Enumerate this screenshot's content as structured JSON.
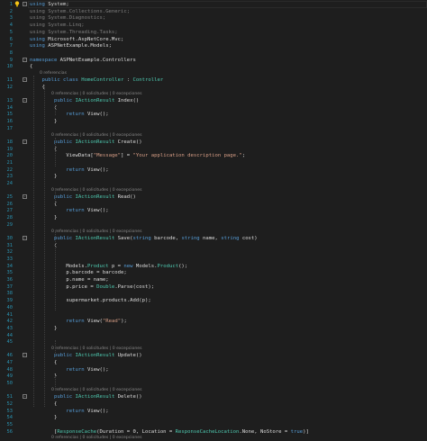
{
  "editor": {
    "codelens": {
      "0refs": "0 referencias",
      "full": "0 referencias | 0 solicitudes | 0 excepciones"
    },
    "lines": [
      {
        "n": "1",
        "fold": "-",
        "segs": [
          [
            "kw",
            "using"
          ],
          [
            "pl",
            " System;"
          ]
        ]
      },
      {
        "n": "2",
        "segs": [
          [
            "dim",
            "using System.Collections.Generic;"
          ]
        ]
      },
      {
        "n": "3",
        "segs": [
          [
            "dim",
            "using System.Diagnostics;"
          ]
        ]
      },
      {
        "n": "4",
        "segs": [
          [
            "dim",
            "using System.Linq;"
          ]
        ]
      },
      {
        "n": "5",
        "segs": [
          [
            "dim",
            "using System.Threading.Tasks;"
          ]
        ]
      },
      {
        "n": "6",
        "segs": [
          [
            "kw",
            "using"
          ],
          [
            "pl",
            " Microsoft.AspNetCore.Mvc;"
          ]
        ]
      },
      {
        "n": "7",
        "segs": [
          [
            "kw",
            "using"
          ],
          [
            "pl",
            " ASPNetExample.Models;"
          ]
        ]
      },
      {
        "n": "8",
        "segs": []
      },
      {
        "n": "9",
        "fold": "-",
        "segs": [
          [
            "kw",
            "namespace"
          ],
          [
            "pl",
            " ASPNetExample.Controllers"
          ]
        ]
      },
      {
        "n": "10",
        "segs": [
          [
            "pl",
            "{"
          ]
        ]
      },
      {
        "lens": "0refs"
      },
      {
        "n": "11",
        "fold": "-",
        "segs": [
          [
            "pl",
            "    "
          ],
          [
            "kw",
            "public class "
          ],
          [
            "ty",
            "HomeController"
          ],
          [
            "pl",
            " : "
          ],
          [
            "ty",
            "Controller"
          ]
        ]
      },
      {
        "n": "12",
        "segs": [
          [
            "pl",
            "    {"
          ]
        ]
      },
      {
        "lens": "full"
      },
      {
        "n": "13",
        "fold": "-",
        "segs": [
          [
            "pl",
            "        "
          ],
          [
            "kw",
            "public "
          ],
          [
            "ty",
            "IActionResult"
          ],
          [
            "pl",
            " Index()"
          ]
        ]
      },
      {
        "n": "14",
        "segs": [
          [
            "pl",
            "        {"
          ]
        ]
      },
      {
        "n": "15",
        "segs": [
          [
            "pl",
            "            "
          ],
          [
            "kw",
            "return"
          ],
          [
            "pl",
            " View();"
          ]
        ]
      },
      {
        "n": "16",
        "segs": [
          [
            "pl",
            "        }"
          ]
        ]
      },
      {
        "n": "17",
        "segs": []
      },
      {
        "lens": "full"
      },
      {
        "n": "18",
        "fold": "-",
        "segs": [
          [
            "pl",
            "        "
          ],
          [
            "kw",
            "public "
          ],
          [
            "ty",
            "IActionResult"
          ],
          [
            "pl",
            " Create()"
          ]
        ]
      },
      {
        "n": "19",
        "segs": [
          [
            "pl",
            "        {"
          ]
        ]
      },
      {
        "n": "20",
        "segs": [
          [
            "pl",
            "            ViewData["
          ],
          [
            "st",
            "\"Message\""
          ],
          [
            "pl",
            "] = "
          ],
          [
            "st",
            "\"Your application description page.\""
          ],
          [
            "pl",
            ";"
          ]
        ]
      },
      {
        "n": "21",
        "segs": []
      },
      {
        "n": "22",
        "segs": [
          [
            "pl",
            "            "
          ],
          [
            "kw",
            "return"
          ],
          [
            "pl",
            " View();"
          ]
        ]
      },
      {
        "n": "23",
        "segs": [
          [
            "pl",
            "        }"
          ]
        ]
      },
      {
        "n": "24",
        "segs": []
      },
      {
        "lens": "full"
      },
      {
        "n": "25",
        "fold": "-",
        "segs": [
          [
            "pl",
            "        "
          ],
          [
            "kw",
            "public "
          ],
          [
            "ty",
            "IActionResult"
          ],
          [
            "pl",
            " Read()"
          ]
        ]
      },
      {
        "n": "26",
        "segs": [
          [
            "pl",
            "        {"
          ]
        ]
      },
      {
        "n": "27",
        "segs": [
          [
            "pl",
            "            "
          ],
          [
            "kw",
            "return"
          ],
          [
            "pl",
            " View();"
          ]
        ]
      },
      {
        "n": "28",
        "segs": [
          [
            "pl",
            "        }"
          ]
        ]
      },
      {
        "n": "29",
        "segs": []
      },
      {
        "lens": "full"
      },
      {
        "n": "30",
        "fold": "-",
        "segs": [
          [
            "pl",
            "        "
          ],
          [
            "kw",
            "public "
          ],
          [
            "ty",
            "IActionResult"
          ],
          [
            "pl",
            " Save("
          ],
          [
            "kw",
            "string"
          ],
          [
            "pl",
            " barcode, "
          ],
          [
            "kw",
            "string"
          ],
          [
            "pl",
            " name, "
          ],
          [
            "kw",
            "string"
          ],
          [
            "pl",
            " cost)"
          ]
        ]
      },
      {
        "n": "31",
        "segs": [
          [
            "pl",
            "        {"
          ]
        ]
      },
      {
        "n": "32",
        "segs": []
      },
      {
        "n": "33",
        "segs": []
      },
      {
        "n": "34",
        "segs": [
          [
            "pl",
            "            Models."
          ],
          [
            "ty",
            "Product"
          ],
          [
            "pl",
            " p = "
          ],
          [
            "kw",
            "new"
          ],
          [
            "pl",
            " Models."
          ],
          [
            "ty",
            "Product"
          ],
          [
            "pl",
            "();"
          ]
        ]
      },
      {
        "n": "35",
        "segs": [
          [
            "pl",
            "            p.barcode = barcode;"
          ]
        ]
      },
      {
        "n": "36",
        "segs": [
          [
            "pl",
            "            p.name = name;"
          ]
        ]
      },
      {
        "n": "37",
        "segs": [
          [
            "pl",
            "            p.price = "
          ],
          [
            "ty",
            "Double"
          ],
          [
            "pl",
            ".Parse(cost);"
          ]
        ]
      },
      {
        "n": "38",
        "segs": []
      },
      {
        "n": "39",
        "segs": [
          [
            "pl",
            "            supermarket.products.Add(p);"
          ]
        ]
      },
      {
        "n": "40",
        "segs": []
      },
      {
        "n": "41",
        "segs": []
      },
      {
        "n": "42",
        "segs": [
          [
            "pl",
            "            "
          ],
          [
            "kw",
            "return"
          ],
          [
            "pl",
            " View("
          ],
          [
            "st",
            "\"Read\""
          ],
          [
            "pl",
            ");"
          ]
        ]
      },
      {
        "n": "43",
        "segs": [
          [
            "pl",
            "        }"
          ]
        ]
      },
      {
        "n": "44",
        "segs": []
      },
      {
        "n": "45",
        "segs": []
      },
      {
        "lens": "full"
      },
      {
        "n": "46",
        "fold": "-",
        "segs": [
          [
            "pl",
            "        "
          ],
          [
            "kw",
            "public "
          ],
          [
            "ty",
            "IActionResult"
          ],
          [
            "pl",
            " Update()"
          ]
        ]
      },
      {
        "n": "47",
        "segs": [
          [
            "pl",
            "        {"
          ]
        ]
      },
      {
        "n": "48",
        "segs": [
          [
            "pl",
            "            "
          ],
          [
            "kw",
            "return"
          ],
          [
            "pl",
            " View();"
          ]
        ]
      },
      {
        "n": "49",
        "segs": [
          [
            "pl",
            "        }"
          ]
        ]
      },
      {
        "n": "50",
        "segs": []
      },
      {
        "lens": "full"
      },
      {
        "n": "51",
        "fold": "-",
        "segs": [
          [
            "pl",
            "        "
          ],
          [
            "kw",
            "public "
          ],
          [
            "ty",
            "IActionResult"
          ],
          [
            "pl",
            " Delete()"
          ]
        ]
      },
      {
        "n": "52",
        "segs": [
          [
            "pl",
            "        {"
          ]
        ]
      },
      {
        "n": "53",
        "segs": [
          [
            "pl",
            "            "
          ],
          [
            "kw",
            "return"
          ],
          [
            "pl",
            " View();"
          ]
        ]
      },
      {
        "n": "54",
        "segs": [
          [
            "pl",
            "        }"
          ]
        ]
      },
      {
        "n": "55",
        "segs": []
      },
      {
        "n": "56",
        "segs": [
          [
            "pl",
            "        ["
          ],
          [
            "ty",
            "ResponseCache"
          ],
          [
            "pl",
            "(Duration = 0, Location = "
          ],
          [
            "ty",
            "ResponseCacheLocation"
          ],
          [
            "pl",
            ".None, NoStore = "
          ],
          [
            "kw",
            "true"
          ],
          [
            "pl",
            ")]"
          ]
        ]
      },
      {
        "lens": "full"
      }
    ]
  },
  "colors": {
    "background": "#1e1e1e",
    "line_number": "#2b91af",
    "keyword": "#569cd6",
    "type": "#4ec9b0",
    "string": "#d69d85",
    "text": "#dcdcdc",
    "codelens": "#8a8a8a"
  },
  "icons": {
    "lightbulb": "lightbulb-icon",
    "fold": "fold-toggle-icon"
  }
}
